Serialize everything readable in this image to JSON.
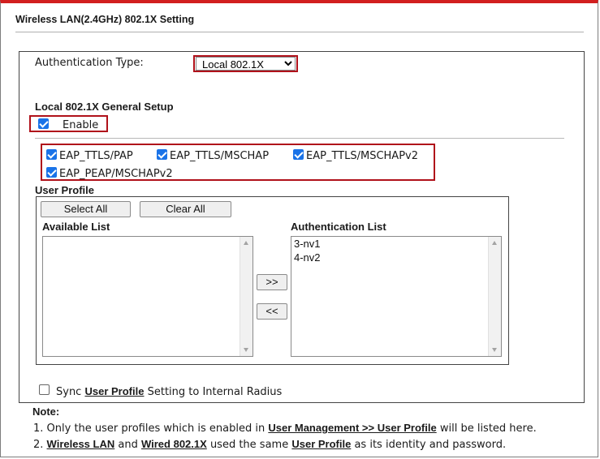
{
  "page": {
    "title": "Wireless LAN(2.4GHz) 802.1X Setting"
  },
  "auth": {
    "label": "Authentication Type:",
    "selected": "Local 802.1X"
  },
  "general": {
    "heading": "Local 802.1X General Setup",
    "enable_label": "Enable",
    "enable_checked": true
  },
  "eap": [
    {
      "label": "EAP_TTLS/PAP",
      "checked": true
    },
    {
      "label": "EAP_TTLS/MSCHAP",
      "checked": true
    },
    {
      "label": "EAP_TTLS/MSCHAPv2",
      "checked": true
    },
    {
      "label": "EAP_PEAP/MSCHAPv2",
      "checked": true
    }
  ],
  "profile": {
    "heading": "User Profile",
    "select_all": "Select All",
    "clear_all": "Clear All",
    "available_heading": "Available List",
    "auth_heading": "Authentication List",
    "available_items": [],
    "auth_items": [
      "3-nv1",
      "4-nv2"
    ],
    "move_right": ">>",
    "move_left": "<<"
  },
  "sync": {
    "prefix": "Sync",
    "link": "User Profile",
    "suffix": "Setting to Internal Radius",
    "checked": false
  },
  "notes": {
    "heading": "Note:",
    "n1": {
      "num": "1.",
      "text_a": "Only the user profiles which is enabled in",
      "link": "User Management >> User Profile",
      "text_b": "will be listed here."
    },
    "n2": {
      "num": "2.",
      "link_a": "Wireless LAN",
      "and": "and",
      "link_b": "Wired 802.1X",
      "text": "used the same",
      "link_c": "User Profile",
      "text_end": "as its identity and password."
    }
  },
  "colors": {
    "accent_red": "#d21f1f",
    "highlight_box": "#b0111a",
    "checkbox_blue": "#1a73e8"
  }
}
